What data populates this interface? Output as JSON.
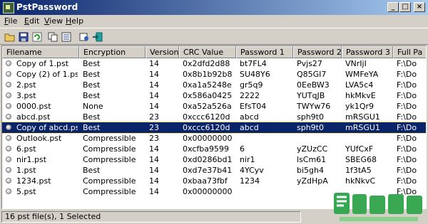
{
  "window": {
    "title": "PstPassword",
    "controls": {
      "minimize": "_",
      "maximize": "□",
      "close": "×"
    }
  },
  "menu": [
    {
      "label": "File",
      "u": "F",
      "rest": "ile"
    },
    {
      "label": "Edit",
      "u": "E",
      "rest": "dit"
    },
    {
      "label": "View",
      "u": "V",
      "rest": "iew"
    },
    {
      "label": "Help",
      "u": "H",
      "rest": "elp"
    }
  ],
  "toolbar": {
    "icons": [
      "open-folder-icon",
      "save-icon",
      "refresh-icon",
      "copy-icon",
      "properties-icon",
      "about-icon",
      "exit-icon"
    ]
  },
  "table": {
    "columns": [
      "Filename",
      "Encryption",
      "Version",
      "CRC Value",
      "Password 1",
      "Password 2",
      "Password 3",
      "Full Pa"
    ],
    "rows": [
      [
        "Copy of 1.pst",
        "Best",
        "14",
        "0x2dfd2d88",
        "bt7FL4",
        "Pvjs27",
        "VNrIjI",
        "F:\\Do"
      ],
      [
        "Copy (2) of 1.pst",
        "Best",
        "14",
        "0x8b1b92b8",
        "SU48Y6",
        "Q85GI7",
        "WMFeYA",
        "F:\\Do"
      ],
      [
        "2.pst",
        "Best",
        "14",
        "0xa1a5248e",
        "gr5q9",
        "0EeBW3",
        "LVA5c4",
        "F:\\Do"
      ],
      [
        "3.pst",
        "Best",
        "14",
        "0x586a0425",
        "2222",
        "YUTqJB",
        "hkMkvE",
        "F:\\Do"
      ],
      [
        "0000.pst",
        "None",
        "14",
        "0xa52a526a",
        "EfsT04",
        "TWYw76",
        "yk1Qr9",
        "F:\\Do"
      ],
      [
        "abcd.pst",
        "Best",
        "23",
        "0xccc6120d",
        "abcd",
        "sph9t0",
        "mRSGU1",
        "F:\\Do"
      ],
      [
        "Copy of abcd.pst",
        "Best",
        "23",
        "0xccc6120d",
        "abcd",
        "sph9t0",
        "mRSGU1",
        "F:\\Do"
      ],
      [
        "Outlook.pst",
        "Compressible",
        "23",
        "0x00000000",
        "",
        "",
        "",
        "F:\\Do"
      ],
      [
        "6.pst",
        "Compressible",
        "14",
        "0xcfba9599",
        "6",
        "yZUzCC",
        "YUfCxF",
        "F:\\Do"
      ],
      [
        "nir1.pst",
        "Compressible",
        "14",
        "0xd0286bd1",
        "nir1",
        "lsCm61",
        "SBEG68",
        "F:\\Do"
      ],
      [
        "1.pst",
        "Best",
        "14",
        "0xd7e37b41",
        "4YCyv",
        "bi5gh4",
        "1f3tA5",
        "F:\\Do"
      ],
      [
        "1234.pst",
        "Compressible",
        "14",
        "0xbaa73fbf",
        "1234",
        "yZdHpA",
        "hkNkvC",
        "F:\\Do"
      ],
      [
        "5.pst",
        "Compressible",
        "14",
        "0x00000000",
        "",
        "",
        "",
        "F:\\Do"
      ]
    ],
    "selected_index": 6
  },
  "status": {
    "text": "16 pst file(s), 1 Selected"
  },
  "colors": {
    "selection": "#0a246a",
    "title_start": "#0a246a",
    "title_end": "#a6caf0"
  }
}
